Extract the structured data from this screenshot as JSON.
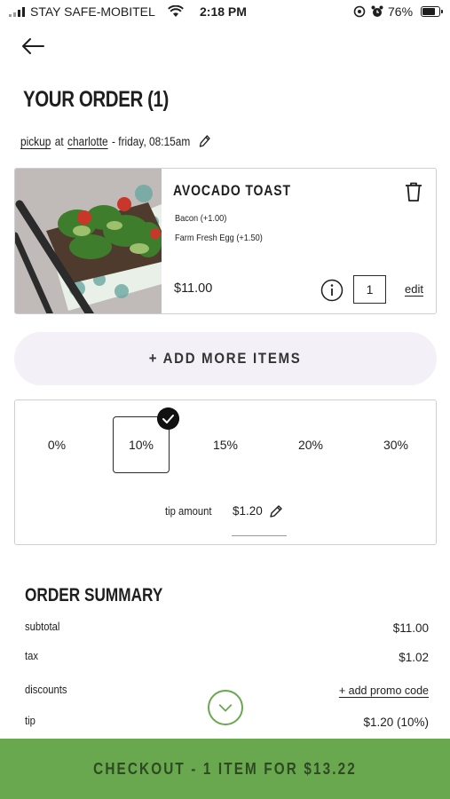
{
  "status_bar": {
    "carrier": "STAY SAFE-MOBITEL",
    "time": "2:18 PM",
    "battery": "76%",
    "battery_level": 0.76
  },
  "header": {
    "title": "YOUR ORDER (1)"
  },
  "pickup": {
    "mode": "pickup",
    "at": "at",
    "location": "charlotte",
    "when": "- friday, 08:15am"
  },
  "item": {
    "name": "AVOCADO TOAST",
    "modifiers": [
      "Bacon (+1.00)",
      "Farm Fresh Egg (+1.50)"
    ],
    "price": "$11.00",
    "quantity": "1",
    "edit_label": "edit"
  },
  "add_more_label": "+ ADD MORE ITEMS",
  "tip": {
    "options": [
      "0%",
      "10%",
      "15%",
      "20%",
      "30%"
    ],
    "selected": "10%",
    "amount_label": "tip amount",
    "amount": "$1.20"
  },
  "summary": {
    "title": "ORDER SUMMARY",
    "rows": [
      {
        "label": "subtotal",
        "value": "$11.00"
      },
      {
        "label": "tax",
        "value": "$1.02"
      },
      {
        "label": "discounts",
        "value": "+ add promo code"
      },
      {
        "label": "tip",
        "value": "$1.20 (10%)"
      }
    ]
  },
  "checkout_label": "CHECKOUT - 1 ITEM FOR $13.22",
  "colors": {
    "accent_green": "#6aa84f",
    "add_more_bg": "#f3f1f7",
    "text": "#1e1e1e"
  },
  "icons": [
    "back-arrow-icon",
    "pencil-icon",
    "trash-icon",
    "info-icon",
    "checkmark-icon",
    "chevron-down-icon",
    "wifi-icon",
    "alarm-icon",
    "battery-icon"
  ]
}
